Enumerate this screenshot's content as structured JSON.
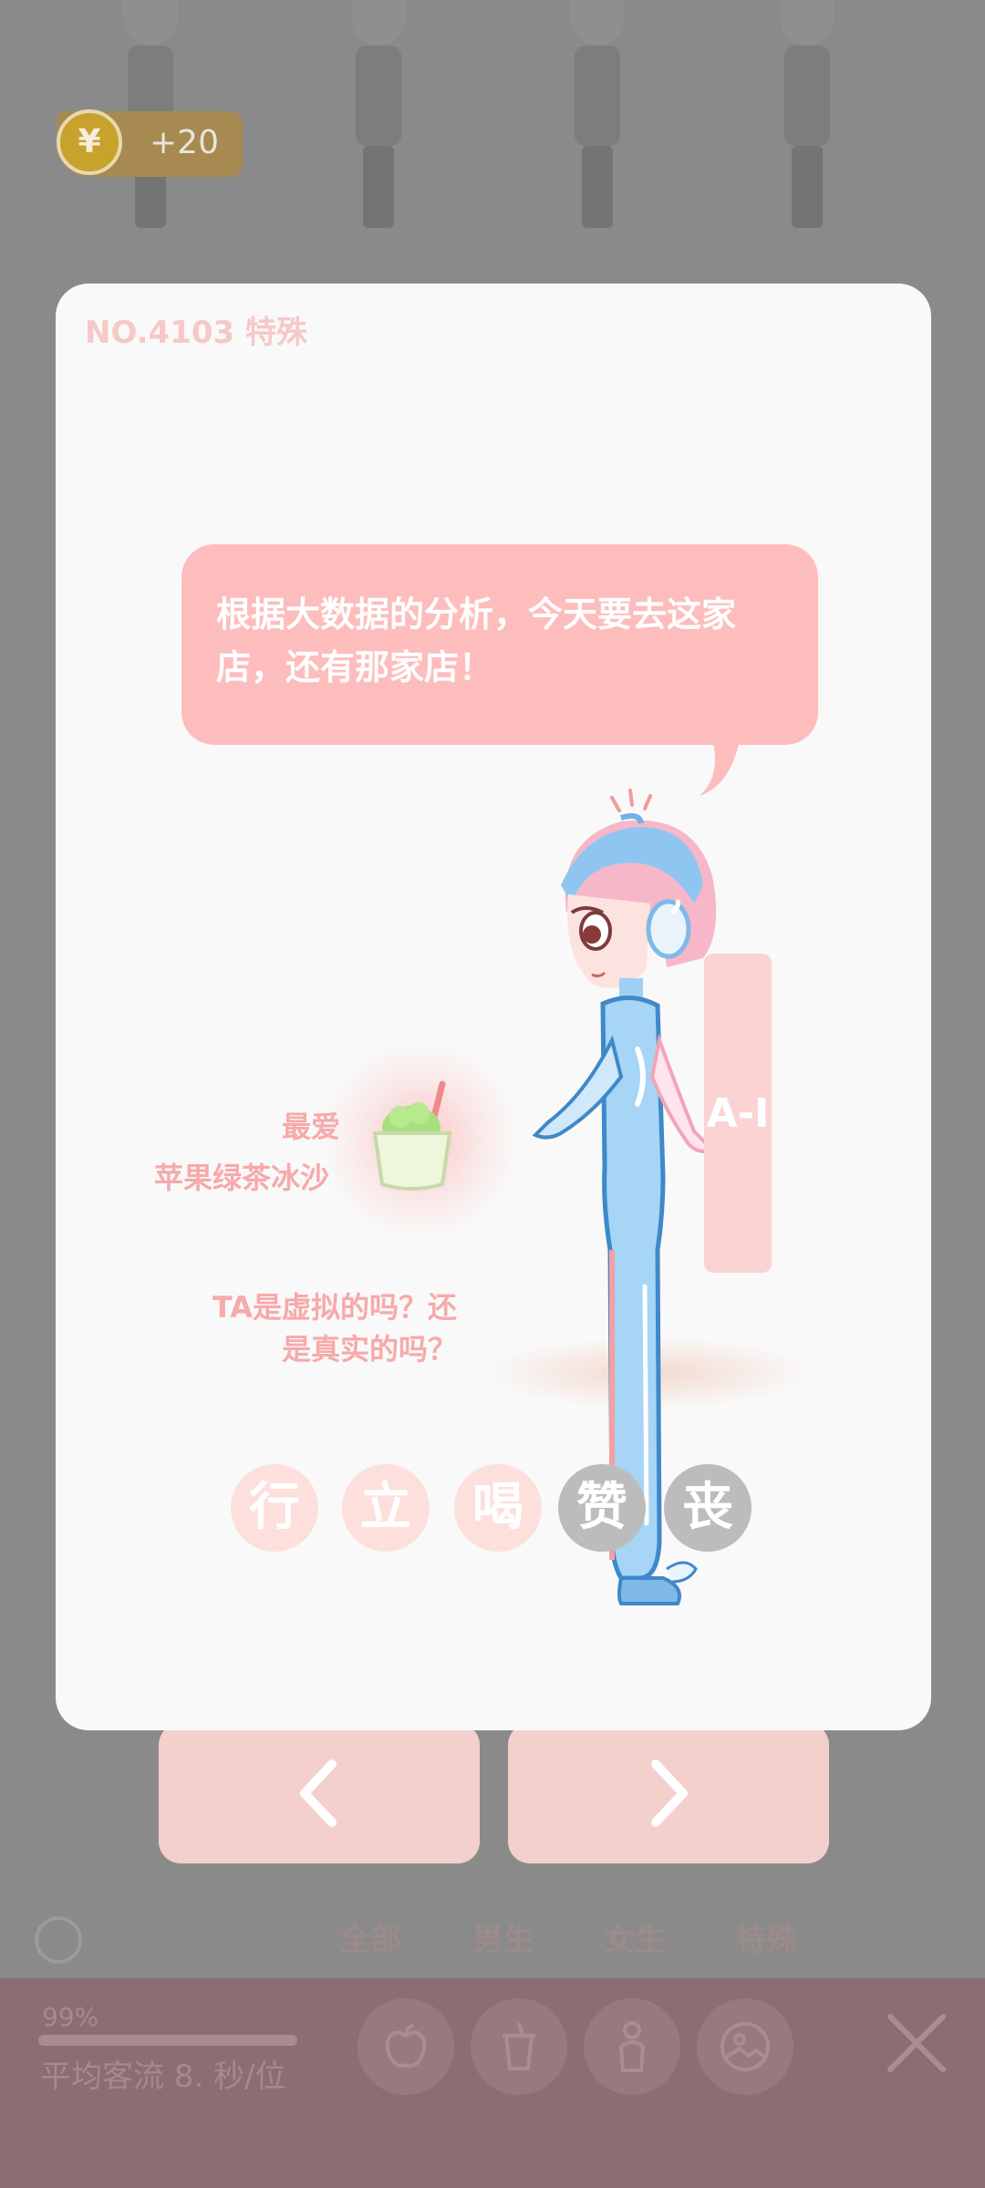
{
  "coins": {
    "icon": "yen-coin-icon",
    "glyph": "¥",
    "delta": "+20"
  },
  "card": {
    "header": "NO.4103  特殊",
    "speech": "根据大数据的分析，今天要去这家店，还有那家店！",
    "tag": "A-I",
    "favorite_label": "最爱",
    "favorite_item": "苹果绿茶冰沙",
    "question_line1": "TA是虚拟的吗？还",
    "question_line2": "是真实的吗？",
    "actions": [
      {
        "label": "行",
        "enabled": true
      },
      {
        "label": "立",
        "enabled": true
      },
      {
        "label": "喝",
        "enabled": true
      },
      {
        "label": "赞",
        "enabled": false
      },
      {
        "label": "丧",
        "enabled": false
      }
    ]
  },
  "nav": {
    "prev_icon": "chevron-left-icon",
    "next_icon": "chevron-right-icon"
  },
  "filter_tabs": [
    "全部",
    "男生",
    "女生",
    "特殊"
  ],
  "stats": {
    "percent": "99%",
    "label": "平均客流  8. 秒/位",
    "progress": 0.99
  },
  "toolbar": {
    "icons": [
      "apple-icon",
      "cup-icon",
      "person-icon",
      "photo-icon",
      "close-icon"
    ]
  },
  "colors": {
    "accent": "#fdbdbd",
    "card": "#f9f9f9",
    "overlay": "#8a8a8a"
  }
}
